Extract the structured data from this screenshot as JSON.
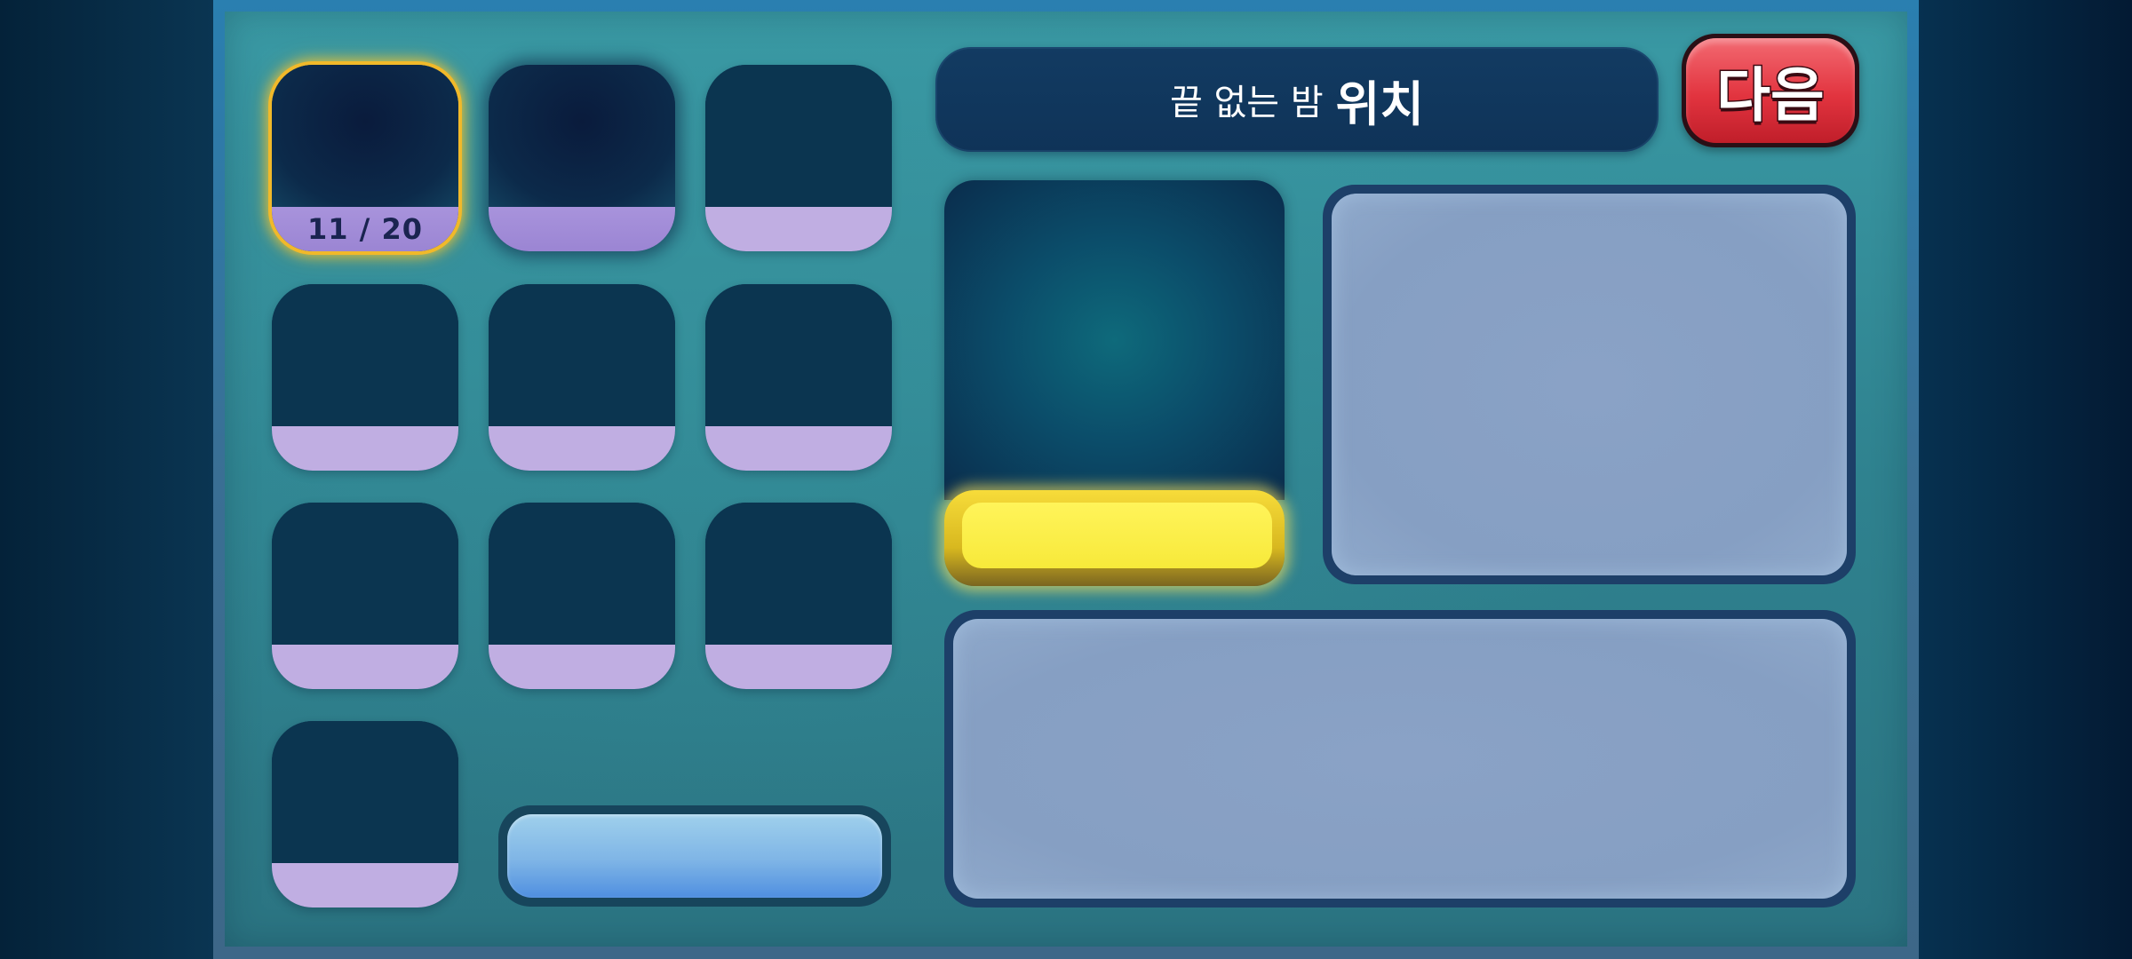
{
  "header": {
    "title_prefix": "끝 없는 밤",
    "title_main": "위치"
  },
  "next_button": {
    "label": "다음"
  },
  "slots": [
    {
      "state": "active",
      "progress": "11 / 20"
    },
    {
      "state": "dim",
      "progress": ""
    },
    {
      "state": "normal",
      "progress": ""
    },
    {
      "state": "normal",
      "progress": ""
    },
    {
      "state": "normal",
      "progress": ""
    },
    {
      "state": "normal",
      "progress": ""
    },
    {
      "state": "normal",
      "progress": ""
    },
    {
      "state": "normal",
      "progress": ""
    },
    {
      "state": "normal",
      "progress": ""
    },
    {
      "state": "normal",
      "progress": ""
    }
  ],
  "colors": {
    "accent_yellow": "#f7e93a",
    "next_red": "#e2343f",
    "slot_bar": "#c0aee2",
    "panel_blue": "#869fc3"
  }
}
